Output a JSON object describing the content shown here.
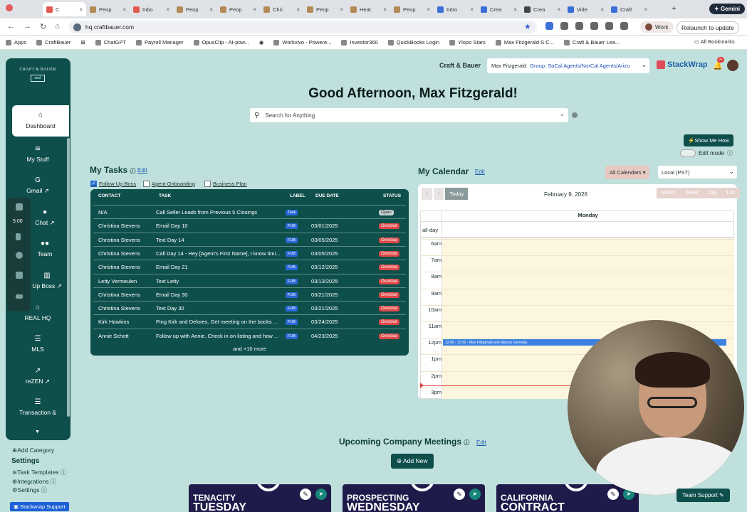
{
  "browser": {
    "tabs": [
      {
        "label": "C",
        "icon": "document-icon",
        "active": true
      },
      {
        "label": "Peop",
        "icon": "document-icon"
      },
      {
        "label": "Inbo",
        "icon": "gmail-icon"
      },
      {
        "label": "Peop",
        "icon": "document-icon"
      },
      {
        "label": "Peop",
        "icon": "document-icon"
      },
      {
        "label": "Chri",
        "icon": "document-icon"
      },
      {
        "label": "Peop",
        "icon": "document-icon"
      },
      {
        "label": "Heat",
        "icon": "document-icon"
      },
      {
        "label": "Peop",
        "icon": "document-icon"
      },
      {
        "label": "Intro",
        "icon": "blue-globe-icon"
      },
      {
        "label": "Crea",
        "icon": "blue-globe-icon"
      },
      {
        "label": "Crea",
        "icon": "chat-icon"
      },
      {
        "label": "Vide",
        "icon": "blue-globe-icon"
      },
      {
        "label": "Craft",
        "icon": "blue-globe-icon"
      }
    ],
    "gemini_label": "Gemini",
    "url": "hq.craftbauer.com",
    "profile_label": "Work",
    "relaunch_label": "Relaunch to update",
    "bookmarks": [
      "Apps",
      "CraftBauer",
      "ChatGPT",
      "Payroll Manager",
      "OpusClip - AI-pow...",
      "Workvivo - Powere...",
      "Investor360",
      "QuickBooks Login",
      "Ylopo Stars",
      "Max Fitzgerald S C...",
      "Craft & Bauer Lea..."
    ],
    "all_bookmarks_label": "All Bookmarks"
  },
  "sidebar": {
    "logo_line1": "CRAFT & BAUER",
    "logo_line2": "real",
    "items": [
      {
        "label": "Dashboard",
        "icon": "home-icon"
      },
      {
        "label": "My Stuff",
        "icon": "layers-icon"
      },
      {
        "label": "Gmail",
        "icon": "google-icon"
      },
      {
        "label": "Chat",
        "icon": "chat-icon"
      },
      {
        "label": "Team",
        "icon": "people-icon"
      },
      {
        "label": "Up Boss",
        "icon": "chart-icon"
      },
      {
        "label": "REAL HQ",
        "icon": "building-icon"
      },
      {
        "label": "MLS",
        "icon": "list-icon"
      },
      {
        "label": "reZEN",
        "icon": "chart-line-icon"
      },
      {
        "label": "Transaction &",
        "icon": "list-icon"
      }
    ],
    "recorder_time": "5:00",
    "add_category": "Add Category",
    "settings_heading": "Settings",
    "settings_links": [
      "Task Templates",
      "Integrations",
      "Settings"
    ],
    "support_label": "Stackwrap Support"
  },
  "header": {
    "brand": "Craft & Bauer",
    "user_name": "Max Fitzgerald",
    "user_group": "Group: SoCal Agents/NorCal Agents/Arizo",
    "stackwrap": "StackWrap",
    "notifications": "9+",
    "greeting": "Good Afternoon, Max Fitzgerald!",
    "search_placeholder": "Search for Anything",
    "show_me_how": "Show Me How",
    "edit_mode": "Edit mode"
  },
  "tasks": {
    "title": "My Tasks",
    "edit": "Edit",
    "filters": [
      {
        "label": "Follow Up Boss",
        "checked": true
      },
      {
        "label": "Agent Onboarding",
        "checked": false
      },
      {
        "label": "Business Plan",
        "checked": false
      }
    ],
    "columns": [
      "CONTACT",
      "TASK",
      "LABEL",
      "DUE DATE",
      "STATUS"
    ],
    "rows": [
      {
        "contact": "N/A",
        "task": "Call Seller Leads from Previous 5 Closings",
        "label": "Task",
        "due": "",
        "status": "Open"
      },
      {
        "contact": "Christina Stevens",
        "task": "Email Day 10",
        "label": "FUB",
        "due": "03/01/2025",
        "status": "Overdue"
      },
      {
        "contact": "Christina Stevens",
        "task": "Text Day 14",
        "label": "FUB",
        "due": "03/05/2025",
        "status": "Overdue"
      },
      {
        "contact": "Christina Stevens",
        "task": "Call Day 14 - Hey [Agent's First Name], I know timi...",
        "label": "FUB",
        "due": "03/05/2025",
        "status": "Overdue"
      },
      {
        "contact": "Christina Stevens",
        "task": "Email Day 21",
        "label": "FUB",
        "due": "03/12/2025",
        "status": "Overdue"
      },
      {
        "contact": "Letty Vermeulen",
        "task": "Text Letty",
        "label": "FUB",
        "due": "03/13/2025",
        "status": "Overdue"
      },
      {
        "contact": "Christina Stevens",
        "task": "Email Day 30",
        "label": "FUB",
        "due": "03/21/2025",
        "status": "Overdue"
      },
      {
        "contact": "Christina Stevens",
        "task": "Text Day 30",
        "label": "FUB",
        "due": "03/21/2025",
        "status": "Overdue"
      },
      {
        "contact": "Kirk Hawkins",
        "task": "Ping Kirk and Delores. Get meeting on the books ...",
        "label": "FUB",
        "due": "03/24/2025",
        "status": "Overdue"
      },
      {
        "contact": "Annie Schott",
        "task": "Follow up with Annie. Check in on listing and how ...",
        "label": "FUB",
        "due": "04/23/2025",
        "status": "Overdue"
      }
    ],
    "more": "and +10 more"
  },
  "calendar": {
    "title": "My Calendar",
    "edit": "Edit",
    "all_calendars": "All Calendars",
    "timezone": "Local (PST)",
    "today": "Today",
    "date": "February 9, 2026",
    "views": [
      "Month",
      "Week",
      "Day",
      "List"
    ],
    "day_name": "Monday",
    "all_day": "all-day",
    "hours": [
      "6am",
      "7am",
      "8am",
      "9am",
      "10am",
      "11am",
      "12pm",
      "1pm",
      "2pm",
      "3pm"
    ],
    "event": "12:00 - 12:30 - Max Fitzgerald and Marcus Genosky"
  },
  "meetings": {
    "title": "Upcoming Company Meetings",
    "edit": "Edit",
    "add_new": "Add New",
    "cards": [
      {
        "line1": "TENACITY",
        "line2": "TUESDAY"
      },
      {
        "line1": "PROSPECTING",
        "line2": "WEDNESDAY"
      },
      {
        "line1": "CALIFORNIA",
        "line2": "CONTRACT"
      }
    ],
    "team_support": "Team Support"
  }
}
